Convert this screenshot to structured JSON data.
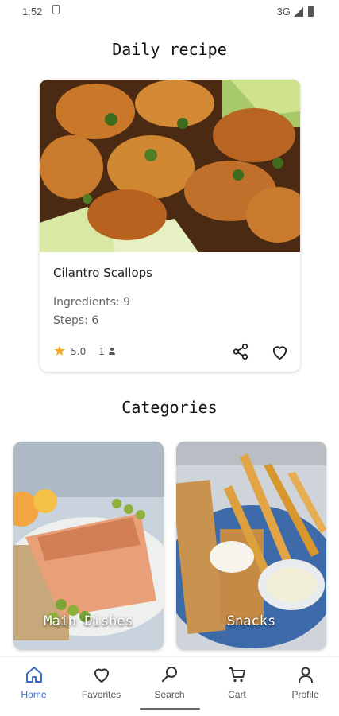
{
  "status": {
    "time": "1:52",
    "network": "3G"
  },
  "daily": {
    "heading": "Daily recipe",
    "recipe": {
      "title": "Cilantro Scallops",
      "ingredients": "Ingredients: 9",
      "steps": "Steps: 6",
      "rating": "5.0",
      "ratings_count": "1"
    }
  },
  "categories": {
    "heading": "Categories",
    "items": [
      {
        "label": "Main Dishes"
      },
      {
        "label": "Snacks"
      }
    ]
  },
  "nav": {
    "items": [
      {
        "label": "Home",
        "icon": "home-icon",
        "active": true
      },
      {
        "label": "Favorites",
        "icon": "heart-icon"
      },
      {
        "label": "Search",
        "icon": "search-icon"
      },
      {
        "label": "Cart",
        "icon": "cart-icon"
      },
      {
        "label": "Profile",
        "icon": "person-icon"
      }
    ],
    "active_color": "#3a6bc9"
  },
  "colors": {
    "star": "#f5a623"
  }
}
